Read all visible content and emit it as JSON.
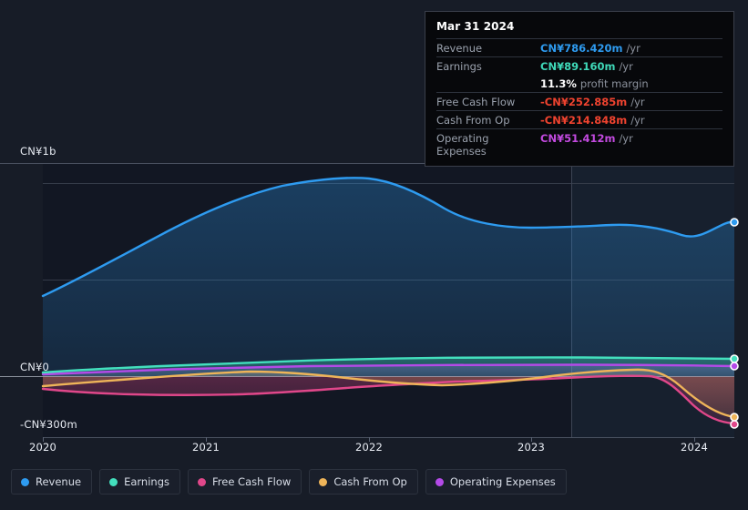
{
  "tooltip": {
    "date": "Mar 31 2024",
    "rows": [
      {
        "name": "Revenue",
        "value": "CN¥786.420m",
        "unit": "/yr",
        "color": "#2e9bf0"
      },
      {
        "name": "Earnings",
        "value": "CN¥89.160m",
        "unit": "/yr",
        "color": "#3fd9b9"
      },
      {
        "name": "",
        "value": "11.3%",
        "unit": "profit margin",
        "color": "#ffffff"
      },
      {
        "name": "Free Cash Flow",
        "value": "-CN¥252.885m",
        "unit": "/yr",
        "color": "#f0432f"
      },
      {
        "name": "Cash From Op",
        "value": "-CN¥214.848m",
        "unit": "/yr",
        "color": "#f0432f"
      },
      {
        "name": "Operating Expenses",
        "value": "CN¥51.412m",
        "unit": "/yr",
        "color": "#c34ae0"
      }
    ]
  },
  "legend": [
    {
      "label": "Revenue",
      "color": "#2e9bf0"
    },
    {
      "label": "Earnings",
      "color": "#43dfbd"
    },
    {
      "label": "Free Cash Flow",
      "color": "#e0478a"
    },
    {
      "label": "Cash From Op",
      "color": "#eeb459"
    },
    {
      "label": "Operating Expenses",
      "color": "#b44ae8"
    }
  ],
  "axis": {
    "y_top": "CN¥1b",
    "y_zero": "CN¥0",
    "y_bottom": "-CN¥300m",
    "x_ticks": [
      "2020",
      "2021",
      "2022",
      "2023",
      "2024"
    ]
  },
  "chart_data": {
    "type": "area",
    "title": "",
    "xlabel": "",
    "ylabel": "CN¥",
    "ylim": [
      -300,
      1000
    ],
    "yticks": [
      1000,
      0,
      -300
    ],
    "ytick_labels": [
      "CN¥1b",
      "CN¥0",
      "-CN¥300m"
    ],
    "xlim": [
      "2019-09",
      "2024-06"
    ],
    "x": [
      "2019-12",
      "2020-03",
      "2020-06",
      "2020-09",
      "2020-12",
      "2021-03",
      "2021-06",
      "2021-09",
      "2021-12",
      "2022-03",
      "2022-06",
      "2022-09",
      "2022-12",
      "2023-03",
      "2023-06",
      "2023-09",
      "2023-12",
      "2024-03"
    ],
    "x_tick_positions": [
      "2020",
      "2021",
      "2022",
      "2023",
      "2024"
    ],
    "grid": true,
    "legend_position": "bottom",
    "forecast_divider_x": "2023-03",
    "units": "CN¥ millions per year",
    "series": [
      {
        "name": "Revenue",
        "color": "#2e9bf0",
        "values": [
          418,
          470,
          540,
          610,
          680,
          745,
          805,
          875,
          950,
          1023,
          1010,
          960,
          900,
          862,
          858,
          860,
          862,
          850,
          800,
          786.42
        ]
      },
      {
        "name": "Earnings",
        "color": "#43dfbd",
        "values": [
          20,
          24,
          30,
          36,
          42,
          48,
          54,
          60,
          66,
          72,
          76,
          80,
          83,
          85,
          86,
          87,
          88,
          89.16
        ]
      },
      {
        "name": "Free Cash Flow",
        "color": "#e0478a",
        "values": [
          -42,
          -46,
          -50,
          -54,
          -58,
          -62,
          -66,
          -70,
          -70,
          -64,
          -52,
          -42,
          -36,
          -32,
          -30,
          -28,
          -30,
          -252.885
        ]
      },
      {
        "name": "Cash From Op",
        "color": "#eeb459",
        "values": [
          -35,
          -30,
          -24,
          -18,
          -12,
          -6,
          0,
          4,
          2,
          -6,
          -18,
          -28,
          -34,
          -32,
          -22,
          -10,
          -4,
          -214.848
        ]
      },
      {
        "name": "Operating Expenses",
        "color": "#b44ae8",
        "values": [
          8,
          10,
          13,
          16,
          19,
          22,
          25,
          28,
          31,
          34,
          37,
          40,
          43,
          45,
          47,
          48,
          50,
          51.412
        ]
      }
    ],
    "final_point_markers": [
      {
        "series": "Revenue",
        "value": 786.42,
        "color": "#2e9bf0"
      },
      {
        "series": "Earnings",
        "value": 89.16,
        "color": "#43dfbd"
      },
      {
        "series": "Operating Expenses",
        "value": 51.412,
        "color": "#b44ae8"
      },
      {
        "series": "Cash From Op",
        "value": -214.848,
        "color": "#eeb459"
      },
      {
        "series": "Free Cash Flow",
        "value": -252.885,
        "color": "#e0478a"
      }
    ]
  }
}
